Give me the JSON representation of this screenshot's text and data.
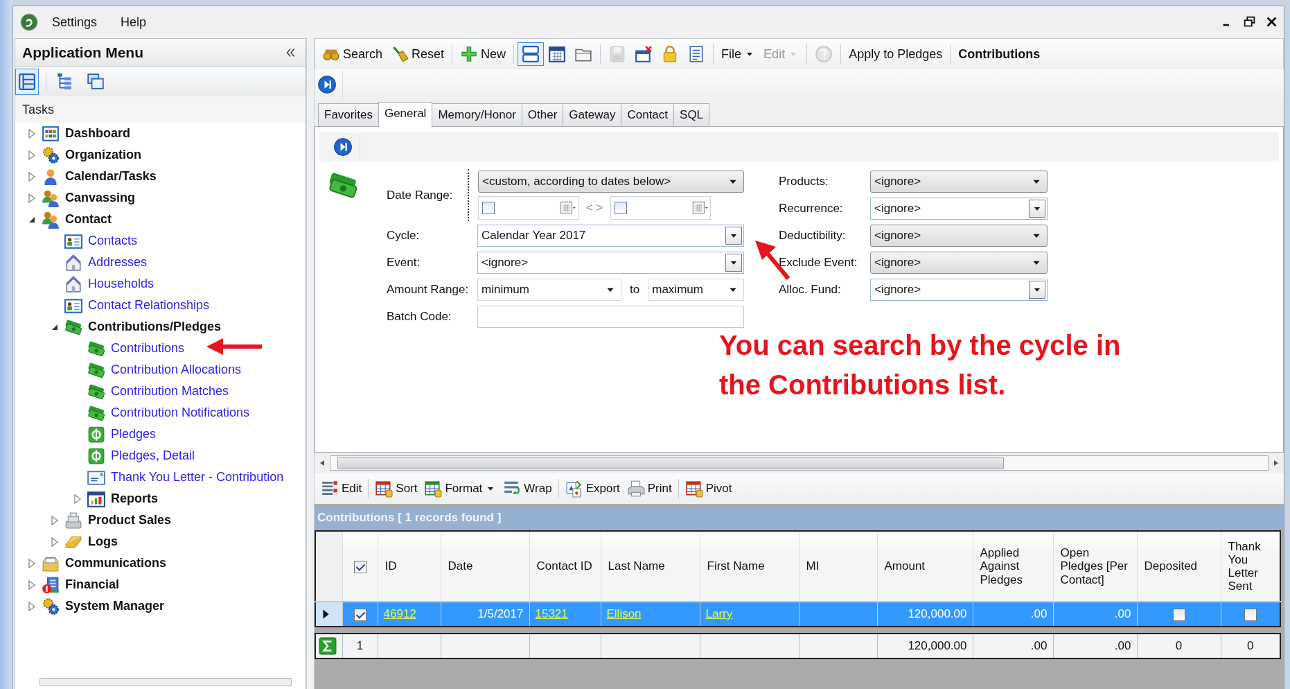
{
  "menu_bar": {
    "items": [
      "Settings",
      "Help"
    ]
  },
  "sidebar": {
    "title": "Application Menu",
    "views": [
      {
        "selected": true
      },
      {
        "selected": false
      },
      {
        "selected": false
      }
    ],
    "section": "Tasks",
    "tree": [
      {
        "label": "Dashboard",
        "kind": "dashboard",
        "expanded": false
      },
      {
        "label": "Organization",
        "kind": "gears",
        "expanded": false
      },
      {
        "label": "Calendar/Tasks",
        "kind": "person",
        "expanded": false
      },
      {
        "label": "Canvassing",
        "kind": "people",
        "expanded": false
      },
      {
        "label": "Contact",
        "kind": "people",
        "expanded": true,
        "children": [
          {
            "label": "Contacts",
            "kind": "card"
          },
          {
            "label": "Addresses",
            "kind": "house"
          },
          {
            "label": "Households",
            "kind": "house"
          },
          {
            "label": "Contact Relationships",
            "kind": "card"
          },
          {
            "label": "Contributions/Pledges",
            "kind": "money",
            "expanded": true,
            "children": [
              {
                "label": "Contributions",
                "kind": "money"
              },
              {
                "label": "Contribution Allocations",
                "kind": "money"
              },
              {
                "label": "Contribution Matches",
                "kind": "money"
              },
              {
                "label": "Contribution Notifications",
                "kind": "money"
              },
              {
                "label": "Pledges",
                "kind": "dollar"
              },
              {
                "label": "Pledges, Detail",
                "kind": "dollar"
              },
              {
                "label": "Thank You Letter - Contribution",
                "kind": "letter"
              },
              {
                "label": "Reports",
                "kind": "report",
                "expanded": false
              }
            ]
          },
          {
            "label": "Product Sales",
            "kind": "register",
            "expanded": false
          },
          {
            "label": "Logs",
            "kind": "notepad",
            "expanded": false
          }
        ]
      },
      {
        "label": "Communications",
        "kind": "box",
        "expanded": false
      },
      {
        "label": "Financial",
        "kind": "building",
        "expanded": false
      },
      {
        "label": "System Manager",
        "kind": "gears",
        "expanded": false
      }
    ]
  },
  "toolbar": {
    "groups": [
      [
        {
          "kind": "search",
          "label": "Search",
          "disabled": false
        },
        {
          "kind": "reset",
          "label": "Reset",
          "disabled": false
        }
      ],
      [
        {
          "kind": "new",
          "label": "New",
          "disabled": false
        }
      ],
      [
        {
          "kind": "layout",
          "pressed": true,
          "disabled": false
        },
        {
          "kind": "calendar",
          "pressed": false,
          "disabled": false
        },
        {
          "kind": "folder",
          "pressed": false,
          "disabled": false
        }
      ],
      [
        {
          "kind": "save",
          "disabled": true
        },
        {
          "kind": "delete",
          "disabled": false
        },
        {
          "kind": "lock",
          "disabled": false
        },
        {
          "kind": "document",
          "disabled": false
        }
      ],
      [
        {
          "kind": "menu",
          "label": "File",
          "disabled": false
        },
        {
          "kind": "menu",
          "label": "Edit",
          "disabled": true
        }
      ],
      [
        {
          "kind": "help",
          "disabled": true
        }
      ],
      [
        {
          "kind": "text",
          "label": "Apply to Pledges",
          "selected": false,
          "disabled": false
        }
      ],
      [
        {
          "kind": "text",
          "label": "Contributions",
          "selected": true,
          "disabled": false
        }
      ]
    ]
  },
  "tabs": [
    {
      "label": "Favorites",
      "selected": false
    },
    {
      "label": "General",
      "selected": true
    },
    {
      "label": "Memory/Honor",
      "selected": false
    },
    {
      "label": "Other",
      "selected": false
    },
    {
      "label": "Gateway",
      "selected": false
    },
    {
      "label": "Contact",
      "selected": false
    },
    {
      "label": "SQL",
      "selected": false
    }
  ],
  "form": {
    "left": [
      {
        "kind": "daterange",
        "label": "Date Range:",
        "value": "<custom, according to dates below>",
        "from_checked": false,
        "to_checked": false,
        "separator": "< >"
      },
      {
        "kind": "combo",
        "label": "Cycle:",
        "value": "Calendar Year 2017"
      },
      {
        "kind": "combo",
        "label": "Event:",
        "value": "<ignore>"
      },
      {
        "kind": "range",
        "label": "Amount Range:",
        "from": "minimum",
        "joiner": "to",
        "to": "maximum"
      },
      {
        "kind": "text",
        "label": "Batch Code:"
      }
    ],
    "right": [
      {
        "kind": "dropdown",
        "label": "Products:",
        "value": "<ignore>"
      },
      {
        "kind": "combo",
        "label": "Recurrence:",
        "value": "<ignore>"
      },
      {
        "kind": "dropdown",
        "label": "Deductibility:",
        "value": "<ignore>"
      },
      {
        "kind": "dropdown",
        "label": "Exclude Event:",
        "value": "<ignore>"
      },
      {
        "kind": "combo",
        "label": "Alloc. Fund:",
        "value": "<ignore>"
      }
    ]
  },
  "annotation": {
    "text": "You can search by the cycle in the Contributions list."
  },
  "grid_toolbar": {
    "groups": [
      [
        {
          "kind": "edit",
          "label": "Edit"
        }
      ],
      [
        {
          "kind": "sort",
          "label": "Sort"
        },
        {
          "kind": "format",
          "label": "Format"
        },
        {
          "kind": "wrap",
          "label": "Wrap"
        }
      ],
      [
        {
          "kind": "export",
          "label": "Export"
        },
        {
          "kind": "print",
          "label": "Print"
        }
      ],
      [
        {
          "kind": "pivot",
          "label": "Pivot"
        }
      ]
    ]
  },
  "grid": {
    "title": "Contributions [ 1 records found ]",
    "select_all_checked": true,
    "columns": [
      {
        "label": "ID",
        "kind": "link"
      },
      {
        "label": "Date",
        "kind": "date"
      },
      {
        "label": "Contact ID",
        "kind": "link"
      },
      {
        "label": "Last Name",
        "kind": "link"
      },
      {
        "label": "First Name",
        "kind": "link"
      },
      {
        "label": "MI",
        "kind": "text"
      },
      {
        "label": "Amount",
        "kind": "number"
      },
      {
        "label": "Applied Against Pledges",
        "kind": "number"
      },
      {
        "label": "Open Pledges [Per Contact]",
        "kind": "number"
      },
      {
        "label": "Deposited",
        "kind": "check"
      },
      {
        "label": "Thank You Letter Sent",
        "kind": "check"
      }
    ],
    "rows": [
      {
        "selected": true,
        "checked": true,
        "cells": [
          "46912",
          "1/5/2017",
          "15321",
          "Ellison",
          "Larry",
          null,
          "120,000.00",
          ".00",
          ".00",
          false,
          false
        ]
      }
    ],
    "totals": {
      "count": "1",
      "cells": [
        null,
        null,
        null,
        null,
        null,
        null,
        "120,000.00",
        ".00",
        ".00",
        "0",
        "0"
      ]
    }
  }
}
